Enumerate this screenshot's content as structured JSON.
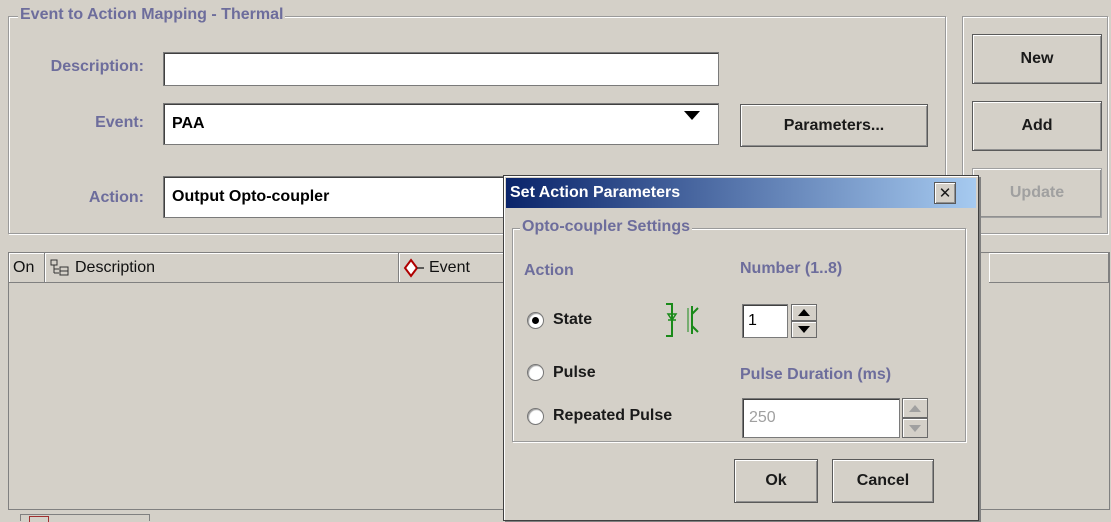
{
  "mapping": {
    "legend": "Event to Action Mapping - Thermal",
    "description_label": "Description:",
    "description_value": "",
    "event_label": "Event:",
    "event_value": "PAA",
    "action_label": "Action:",
    "action_value": "Output Opto-coupler",
    "parameters_button": "Parameters..."
  },
  "side_buttons": {
    "new": "New",
    "add": "Add",
    "update": "Update"
  },
  "table": {
    "columns": [
      {
        "label": "On",
        "icon": ""
      },
      {
        "label": "Description",
        "icon": "tree-icon"
      },
      {
        "label": "Event",
        "icon": "diamond-icon"
      }
    ]
  },
  "dialog": {
    "title": "Set Action Parameters",
    "legend": "Opto-coupler Settings",
    "action_header": "Action",
    "number_header": "Number (1..8)",
    "number_value": "1",
    "pulse_duration_header": "Pulse Duration (ms)",
    "pulse_duration_value": "250",
    "options": [
      "State",
      "Pulse",
      "Repeated Pulse"
    ],
    "selected_option": "State",
    "ok": "Ok",
    "cancel": "Cancel"
  },
  "colors": {
    "label": "#6d6d9c",
    "title_bar": "#0a246a",
    "background": "#d4d0c8"
  }
}
